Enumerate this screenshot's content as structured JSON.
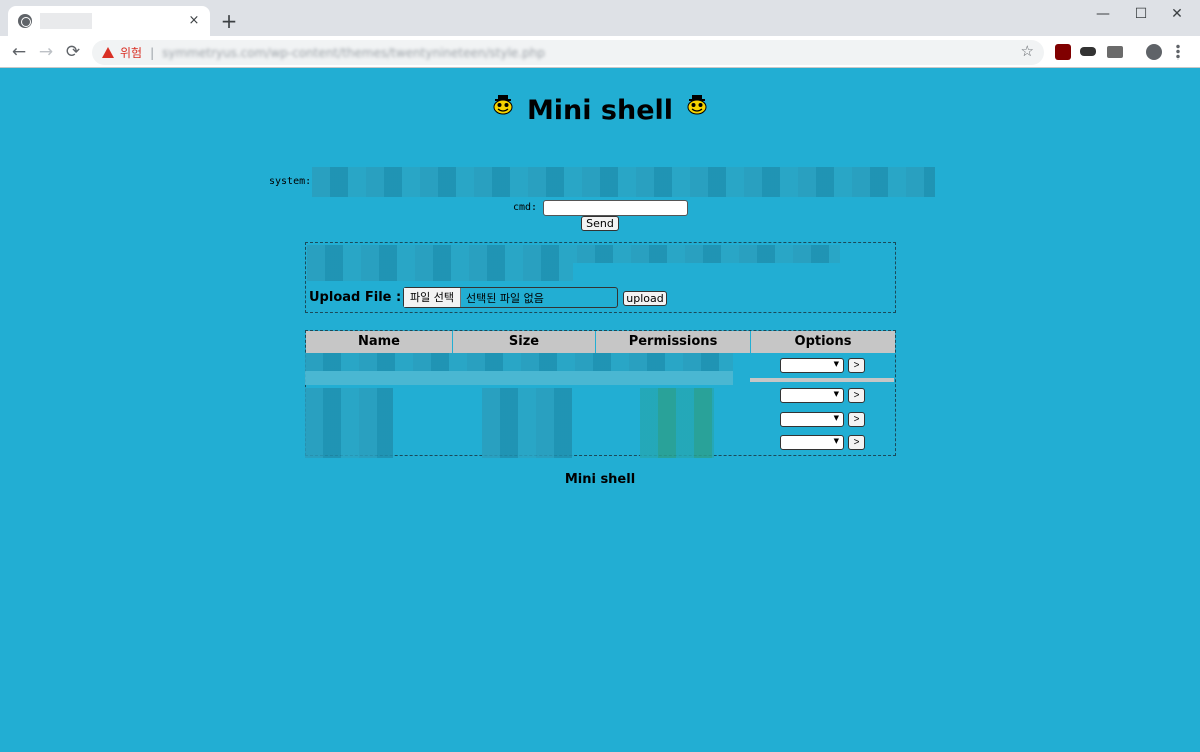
{
  "browser": {
    "tab_close": "×",
    "new_tab": "+",
    "minimize": "—",
    "maximize": "☐",
    "close": "✕",
    "back": "←",
    "forward": "→",
    "reload": "⟳",
    "security_label": "위험",
    "url": "symmetryus.com/wp-content/themes/twentynineteen/style.php",
    "bookmark": "☆",
    "colors": {
      "tabstrip": "#dee1e6",
      "warning": "#d93025"
    }
  },
  "page": {
    "title": "Mini shell",
    "system_label": "system:",
    "cmd_label": "cmd:",
    "send_label": "Send",
    "upload_label": "Upload File :",
    "file_choose_label": "파일 선택",
    "file_none_label": "선택된 파일 없음",
    "upload_button": "upload",
    "table": {
      "headers": [
        "Name",
        "Size",
        "Permissions",
        "Options"
      ]
    },
    "row_action_label": ">",
    "footer": "Mini shell",
    "colors": {
      "background": "#22aed3",
      "header_bg": "#c6c6c6"
    }
  }
}
